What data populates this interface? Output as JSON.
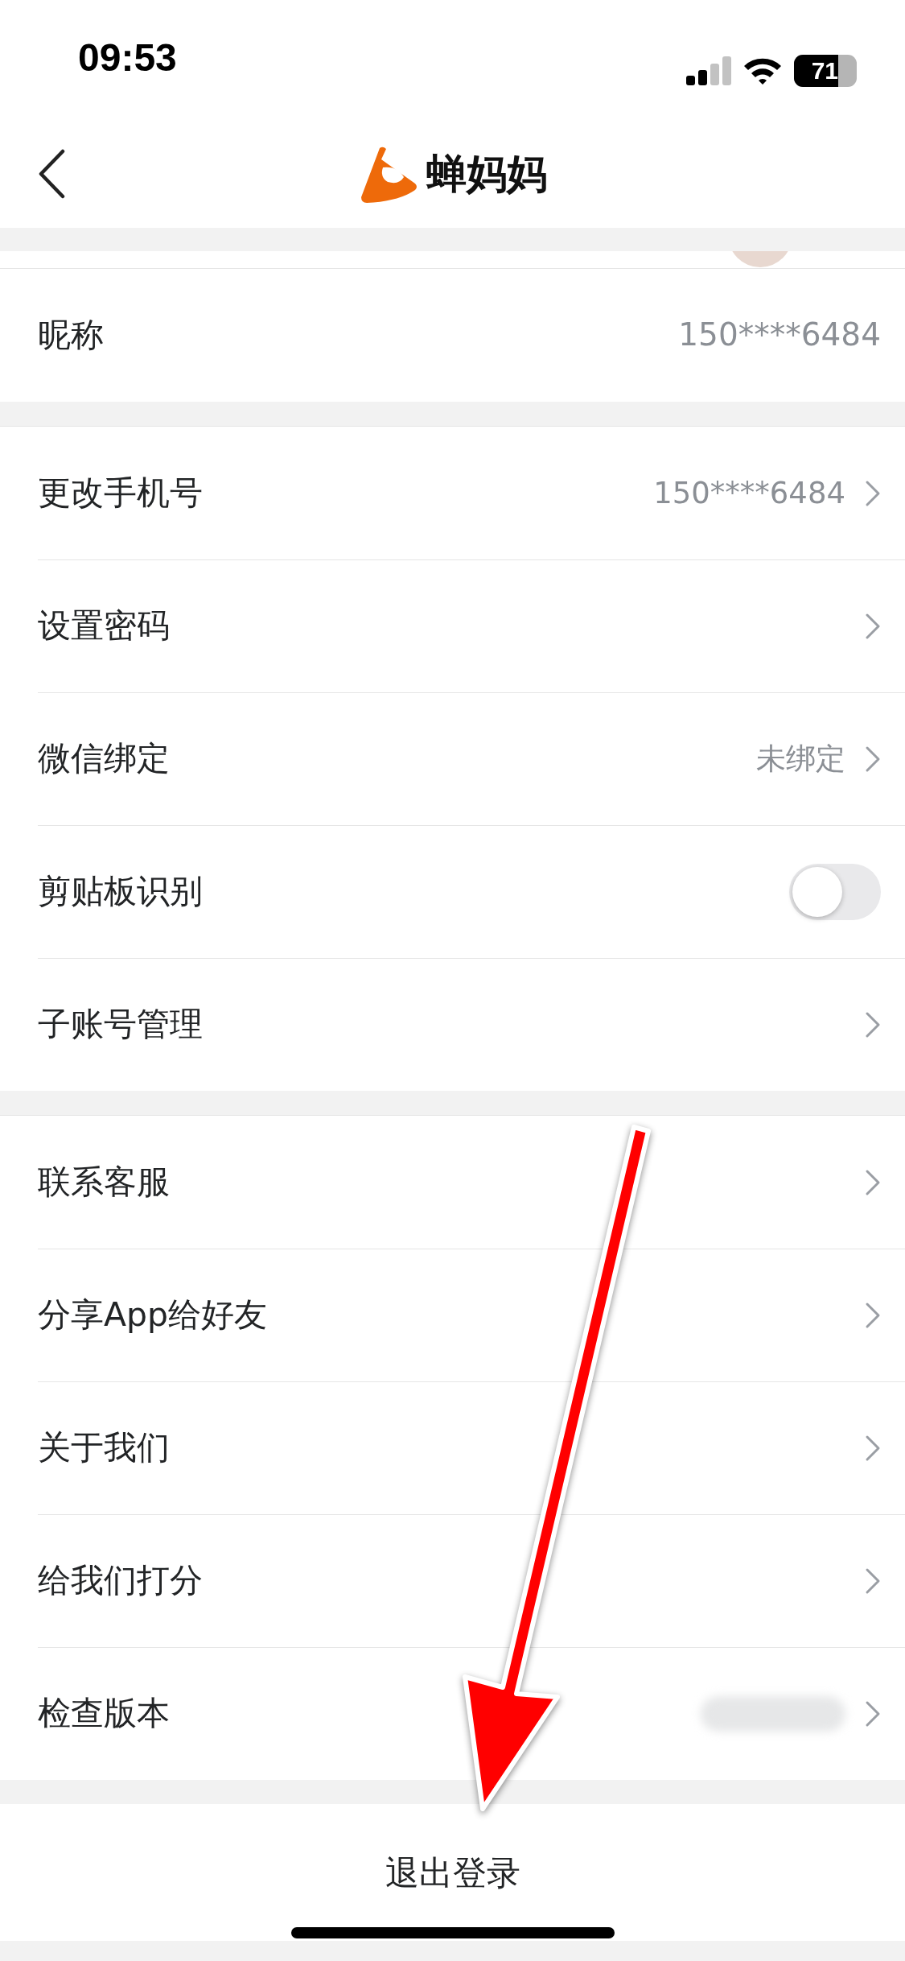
{
  "status_bar": {
    "time": "09:53",
    "battery": "71"
  },
  "header": {
    "title": "蝉妈妈"
  },
  "groups": [
    {
      "rows": [
        {
          "kind": "value",
          "label": "昵称",
          "value": "150****6484"
        }
      ]
    },
    {
      "rows": [
        {
          "kind": "link",
          "label": "更改手机号",
          "value": "150****6484"
        },
        {
          "kind": "link",
          "label": "设置密码"
        },
        {
          "kind": "link",
          "label": "微信绑定",
          "value": "未绑定"
        },
        {
          "kind": "toggle",
          "label": "剪贴板识别",
          "on": false
        },
        {
          "kind": "link",
          "label": "子账号管理"
        }
      ]
    },
    {
      "rows": [
        {
          "kind": "link",
          "label": "联系客服"
        },
        {
          "kind": "link",
          "label": "分享App给好友"
        },
        {
          "kind": "link",
          "label": "关于我们"
        },
        {
          "kind": "link",
          "label": "给我们打分"
        },
        {
          "kind": "hidden",
          "label": "检查版本"
        }
      ]
    }
  ],
  "logout": {
    "label": "退出登录"
  }
}
